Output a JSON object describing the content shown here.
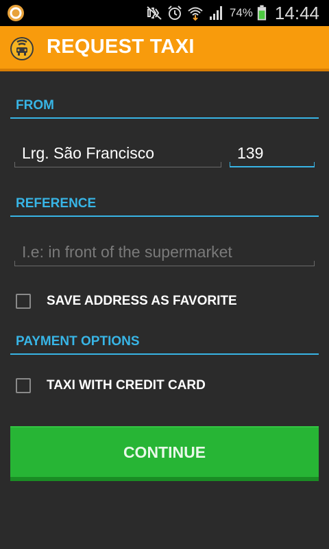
{
  "status_bar": {
    "battery_percent": "74%",
    "time": "14:44",
    "icons": [
      "app-notification-icon",
      "mute-icon",
      "alarm-icon",
      "wifi-download-icon",
      "signal-icon",
      "battery-icon"
    ]
  },
  "action_bar": {
    "title": "REQUEST TAXI",
    "logo": "taxi-logo-icon"
  },
  "from": {
    "header": "FROM",
    "street_value": "Lrg. São Francisco",
    "number_value": "139"
  },
  "reference": {
    "header": "REFERENCE",
    "placeholder": "I.e: in front of the supermarket"
  },
  "favorite": {
    "label": "SAVE ADDRESS AS FAVORITE",
    "checked": false
  },
  "payment": {
    "header": "PAYMENT OPTIONS",
    "credit_card_label": "TAXI WITH CREDIT CARD",
    "credit_card_checked": false
  },
  "continue_label": "CONTINUE",
  "colors": {
    "accent_blue": "#38b5e6",
    "action_bar_orange": "#f89b0c",
    "continue_green": "#27b535",
    "background": "#2b2b2b"
  }
}
